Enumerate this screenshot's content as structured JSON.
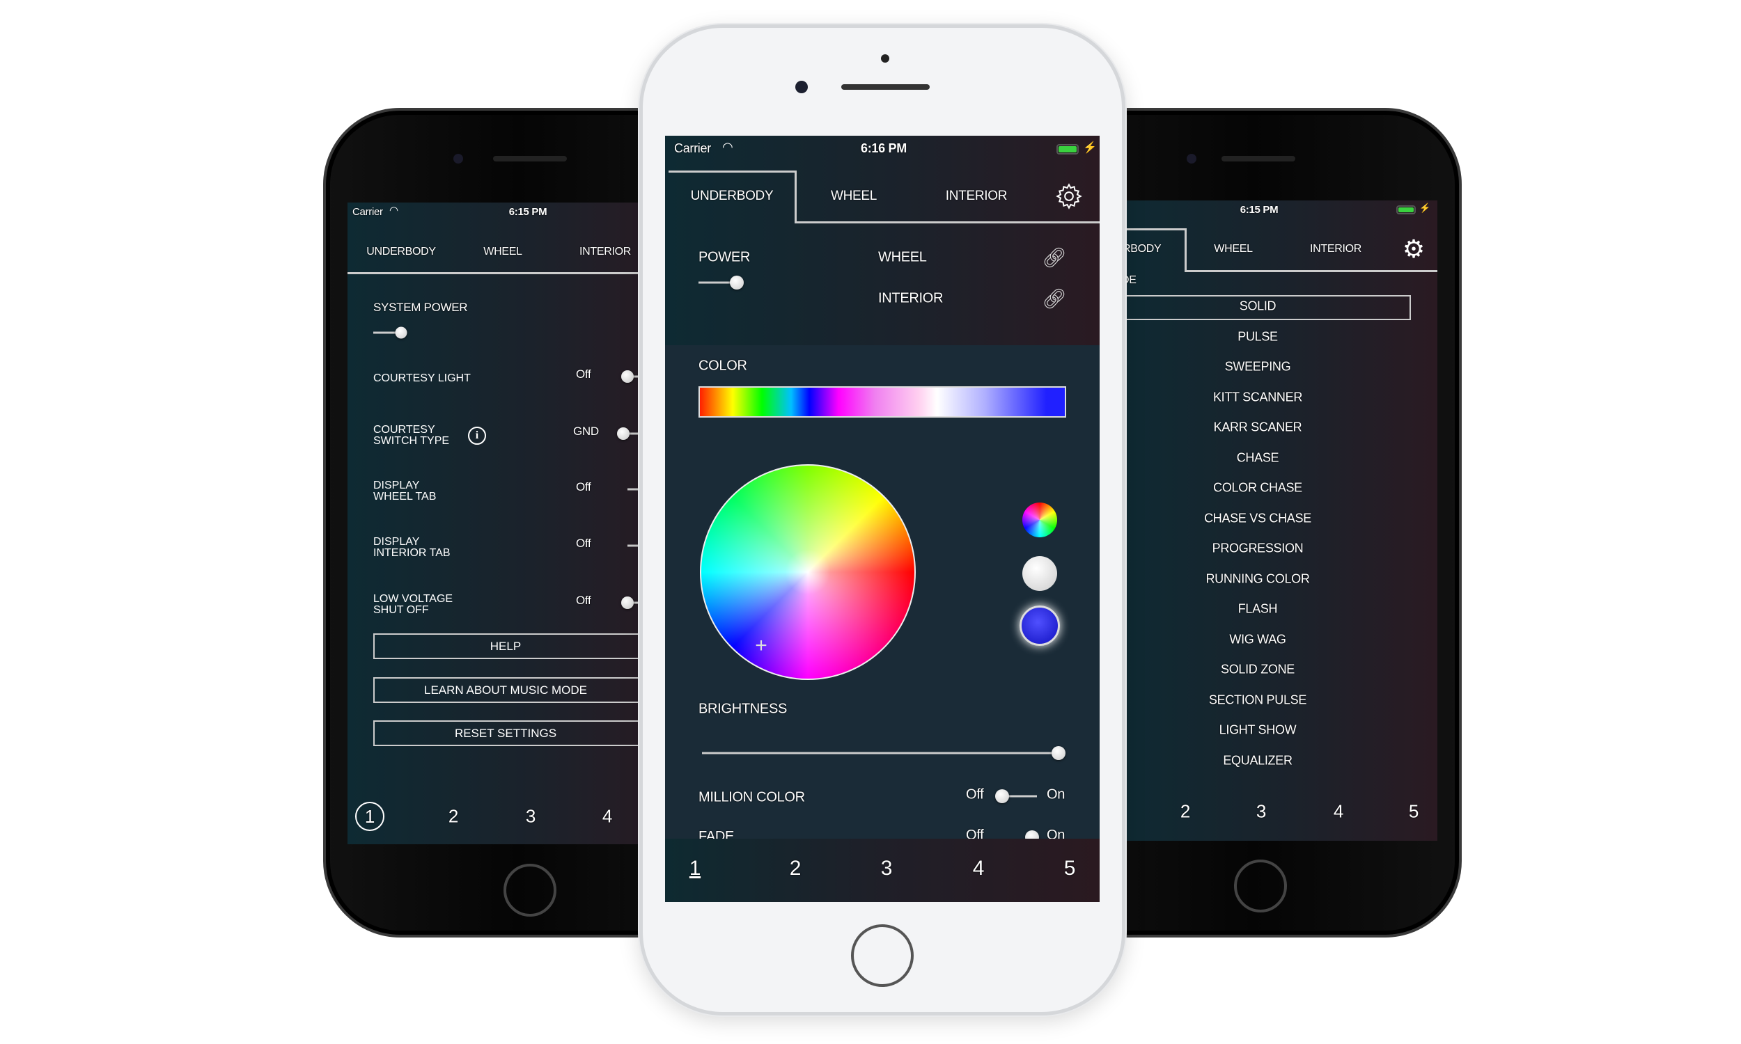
{
  "left_phone": {
    "status": {
      "carrier": "Carrier",
      "time": "6:15 PM"
    },
    "tabs": [
      "UNDERBODY",
      "WHEEL",
      "INTERIOR"
    ],
    "system_power": "SYSTEM POWER",
    "settings": [
      {
        "label": [
          "COURTESY LIGHT"
        ],
        "value": "Off",
        "toggle": "knob"
      },
      {
        "label": [
          "COURTESY",
          "SWITCH TYPE"
        ],
        "value": "GND",
        "toggle": "knob",
        "info": true
      },
      {
        "label": [
          "DISPLAY",
          "WHEEL TAB"
        ],
        "value": "Off",
        "toggle": "line"
      },
      {
        "label": [
          "DISPLAY",
          "INTERIOR TAB"
        ],
        "value": "Off",
        "toggle": "line"
      },
      {
        "label": [
          "LOW VOLTAGE",
          "SHUT OFF"
        ],
        "value": "Off",
        "toggle": "knob"
      }
    ],
    "buttons": [
      "HELP",
      "LEARN ABOUT MUSIC MODE",
      "RESET SETTINGS"
    ],
    "pages": [
      "1",
      "2",
      "3",
      "4"
    ],
    "active_page": "1"
  },
  "center_phone": {
    "status": {
      "carrier": "Carrier",
      "time": "6:16 PM",
      "battery_color": "#3ad13f"
    },
    "tabs": [
      "UNDERBODY",
      "WHEEL",
      "INTERIOR"
    ],
    "active_tab": "UNDERBODY",
    "power_label": "POWER",
    "links": [
      "WHEEL",
      "INTERIOR"
    ],
    "color_label": "COLOR",
    "swatches": [
      "rainbow",
      "#ffffff",
      "#2020e0"
    ],
    "brightness_label": "BRIGHTNESS",
    "brightness": 100,
    "million_color": {
      "label": "MILLION COLOR",
      "off": "Off",
      "on": "On",
      "state": "Off"
    },
    "fade": {
      "label": "FADE",
      "off": "Off",
      "on": "On"
    },
    "pages": [
      "1",
      "2",
      "3",
      "4",
      "5"
    ],
    "active_page": "1"
  },
  "right_phone": {
    "status": {
      "time": "6:15 PM"
    },
    "tabs": [
      "RBODY",
      "WHEEL",
      "INTERIOR"
    ],
    "section_label": "DE",
    "modes": [
      "SOLID",
      "PULSE",
      "SWEEPING",
      "KITT SCANNER",
      "KARR SCANER",
      "CHASE",
      "COLOR CHASE",
      "CHASE VS CHASE",
      "PROGRESSION",
      "RUNNING COLOR",
      "FLASH",
      "WIG WAG",
      "SOLID ZONE",
      "SECTION PULSE",
      "LIGHT SHOW",
      "EQUALIZER"
    ],
    "selected_mode": "SOLID",
    "pages": [
      "2",
      "3",
      "4",
      "5"
    ]
  }
}
